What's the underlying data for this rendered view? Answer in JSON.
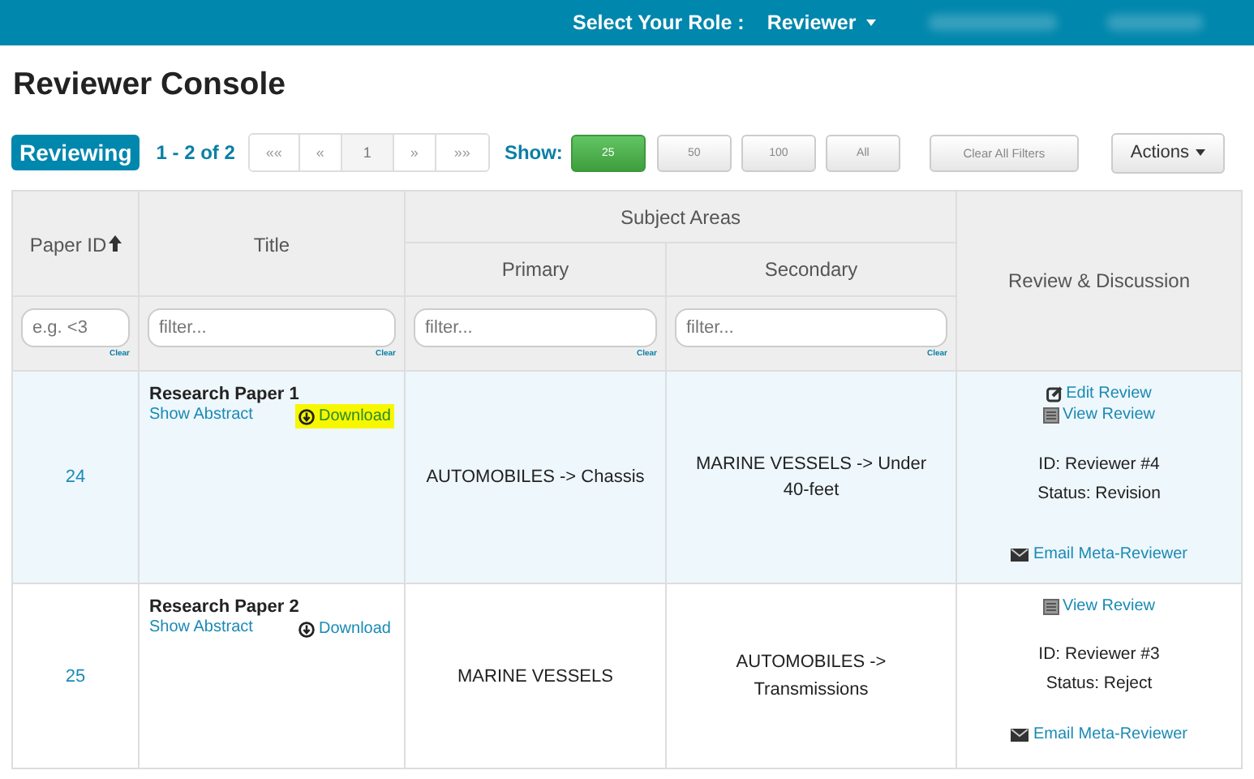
{
  "top_bar": {
    "role_label": "Select Your Role :",
    "role_value": "Reviewer"
  },
  "page_title": "Reviewer Console",
  "toolbar": {
    "mode_badge": "Reviewing",
    "range": "1 - 2 of 2",
    "pagination": [
      {
        "label": "««",
        "selected": false
      },
      {
        "label": "«",
        "selected": false
      },
      {
        "label": "1",
        "selected": true
      },
      {
        "label": "»",
        "selected": false
      },
      {
        "label": "»»",
        "selected": false
      }
    ],
    "show_label": "Show:",
    "page_sizes": [
      {
        "label": "25",
        "selected": true
      },
      {
        "label": "50",
        "selected": false
      },
      {
        "label": "100",
        "selected": false
      },
      {
        "label": "All",
        "selected": false
      }
    ],
    "clear_filters": "Clear All Filters",
    "actions": "Actions"
  },
  "table": {
    "columns": {
      "paper_id": "Paper ID",
      "title": "Title",
      "subject_areas": "Subject Areas",
      "primary": "Primary",
      "secondary": "Secondary",
      "review": "Review & Discussion"
    },
    "filters": [
      {
        "placeholder": "e.g. <3",
        "clear": "Clear"
      },
      {
        "placeholder": "filter...",
        "clear": "Clear"
      },
      {
        "placeholder": "filter...",
        "clear": "Clear"
      },
      {
        "placeholder": "filter...",
        "clear": "Clear"
      }
    ],
    "rows": [
      {
        "id": "24",
        "title": "Research Paper 1",
        "abstract_link": "Show Abstract",
        "download": {
          "label": "Download",
          "highlighted": true
        },
        "primary": "AUTOMOBILES -> Chassis",
        "secondary": "MARINE VESSELS -> Under 40-feet",
        "highlighted": true,
        "links": [
          {
            "kind": "edit",
            "label": "Edit Review"
          },
          {
            "kind": "view",
            "label": "View Review"
          }
        ],
        "reviewer": "ID: Reviewer #4",
        "status": "Status: Revision",
        "email": "Email Meta-Reviewer"
      },
      {
        "id": "25",
        "title": "Research Paper 2",
        "abstract_link": "Show Abstract",
        "download": {
          "label": "Download",
          "highlighted": false
        },
        "primary": "MARINE VESSELS",
        "secondary": "AUTOMOBILES -> Transmissions",
        "highlighted": false,
        "links": [
          {
            "kind": "view",
            "label": "View Review"
          }
        ],
        "reviewer": "ID: Reviewer #3",
        "status": "Status: Reject",
        "email": "Email Meta-Reviewer"
      }
    ]
  }
}
